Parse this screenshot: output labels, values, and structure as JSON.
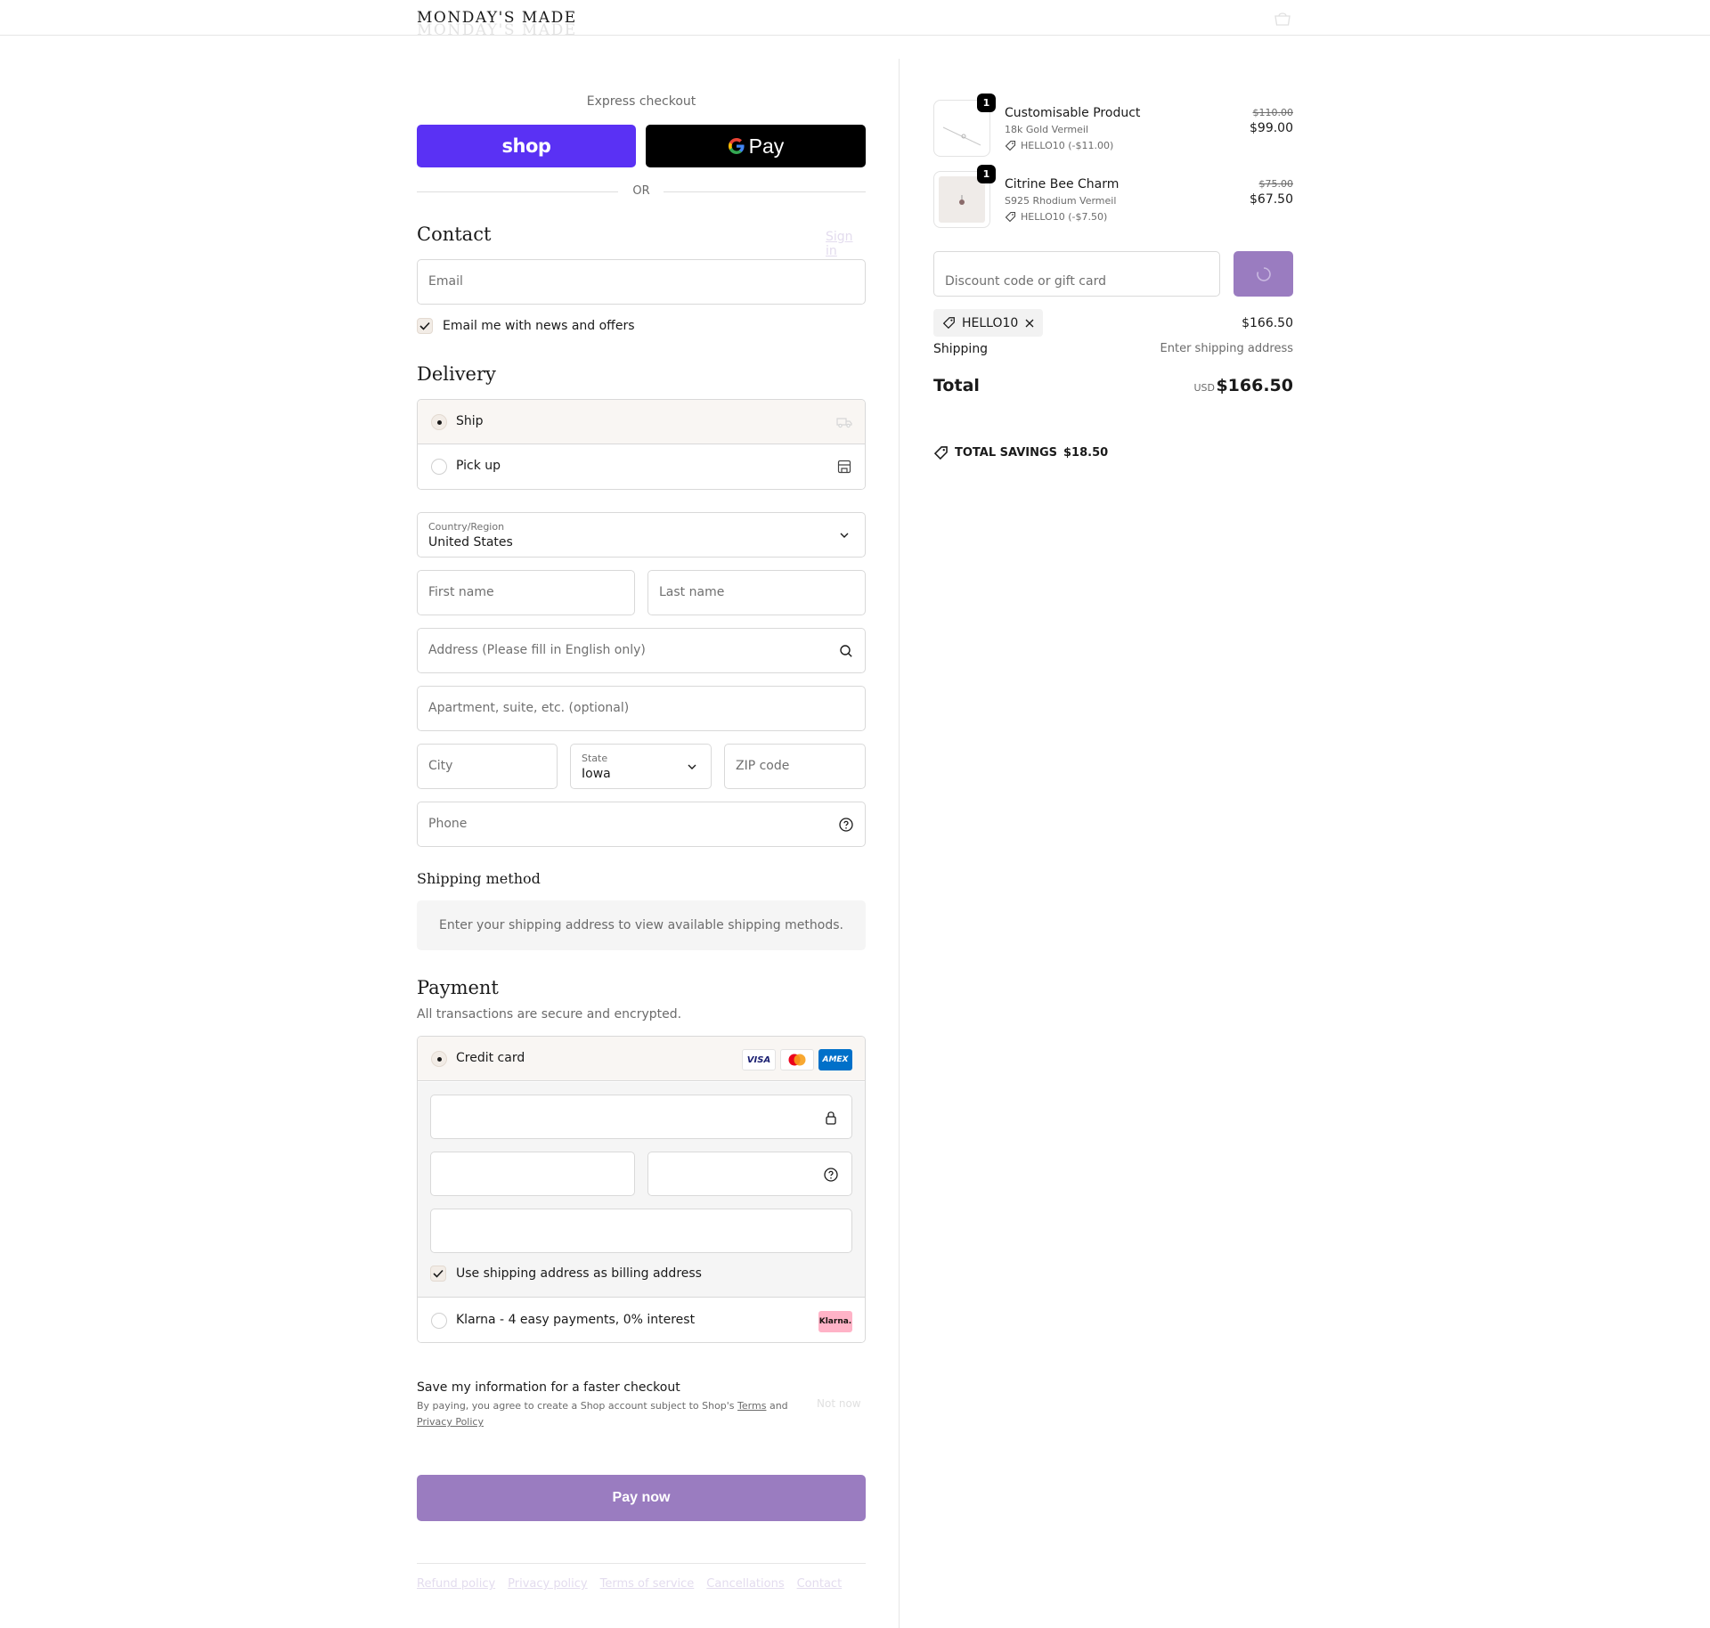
{
  "brand": {
    "name": "MONDAY'S MADE"
  },
  "colors": {
    "shop_purple": "#5a31f4",
    "accent": "#9a7cc0",
    "selected_bg": "#f9f6f3"
  },
  "express": {
    "title": "Express checkout",
    "shop_label": "shop",
    "gpay_label": "Pay",
    "or_label": "OR"
  },
  "contact": {
    "heading": "Contact",
    "sign_in": "Sign in",
    "email_placeholder": "Email",
    "newsletter_label": "Email me with news and offers",
    "newsletter_checked": true
  },
  "delivery": {
    "heading": "Delivery",
    "options": [
      {
        "label": "Ship",
        "selected": true,
        "icon": "truck-icon"
      },
      {
        "label": "Pick up",
        "selected": false,
        "icon": "store-icon"
      }
    ],
    "country_label": "Country/Region",
    "country_value": "United States",
    "first_name_placeholder": "First name",
    "last_name_placeholder": "Last name",
    "address_placeholder": "Address (Please fill in English only)",
    "apartment_placeholder": "Apartment, suite, etc. (optional)",
    "city_placeholder": "City",
    "state_label": "State",
    "state_value": "Iowa",
    "zip_placeholder": "ZIP code",
    "phone_placeholder": "Phone"
  },
  "shipping_method": {
    "heading": "Shipping method",
    "message": "Enter your shipping address to view available shipping methods."
  },
  "payment": {
    "heading": "Payment",
    "subtitle": "All transactions are secure and encrypted.",
    "credit_card_label": "Credit card",
    "card_brands": [
      "VISA",
      "Mastercard",
      "AMEX"
    ],
    "billing_same_label": "Use shipping address as billing address",
    "billing_same_checked": true,
    "klarna_label": "Klarna - 4 easy payments, 0% interest",
    "klarna_badge": "Klarna."
  },
  "save_info": {
    "title": "Save my information for a faster checkout",
    "text_before": "By paying, you agree to create a Shop account subject to Shop's",
    "terms": "Terms",
    "and": "and",
    "privacy": "Privacy Policy",
    "not_now": "Not now"
  },
  "pay_button": "Pay now",
  "footer_links": [
    "Refund policy",
    "Privacy policy",
    "Terms of service",
    "Cancellations",
    "Contact"
  ],
  "summary": {
    "items": [
      {
        "name": "Customisable Product",
        "variant": "18k Gold Vermeil",
        "discount": "HELLO10 (-$11.00)",
        "qty": "1",
        "old_price": "$110.00",
        "price": "$99.00"
      },
      {
        "name": "Citrine Bee Charm",
        "variant": "S925 Rhodium Vermeil",
        "discount": "HELLO10 (-$7.50)",
        "qty": "1",
        "old_price": "$75.00",
        "price": "$67.50"
      }
    ],
    "discount_placeholder": "Discount code or gift card",
    "applied_code": "HELLO10",
    "subtotal": "$166.50",
    "shipping_label": "Shipping",
    "shipping_value": "Enter shipping address",
    "total_label": "Total",
    "currency": "USD",
    "total": "$166.50",
    "savings_label": "TOTAL SAVINGS",
    "savings_value": "$18.50"
  }
}
